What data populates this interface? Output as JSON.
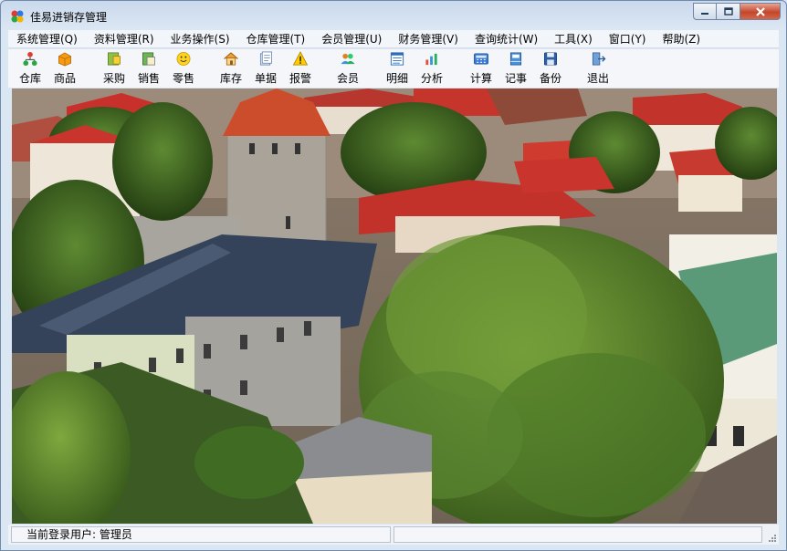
{
  "window": {
    "title": "佳易进销存管理"
  },
  "menu": [
    "系统管理(Q)",
    "资料管理(R)",
    "业务操作(S)",
    "仓库管理(T)",
    "会员管理(U)",
    "财务管理(V)",
    "查询统计(W)",
    "工具(X)",
    "窗口(Y)",
    "帮助(Z)"
  ],
  "toolbar": {
    "warehouse": "仓库",
    "goods": "商品",
    "purchase": "采购",
    "sales": "销售",
    "retail": "零售",
    "stock": "库存",
    "documents": "单据",
    "alarm": "报警",
    "member": "会员",
    "detail": "明细",
    "analysis": "分析",
    "calculate": "计算",
    "notes": "记事",
    "backup": "备份",
    "exit": "退出"
  },
  "status": {
    "current_user": "当前登录用户: 管理员"
  }
}
